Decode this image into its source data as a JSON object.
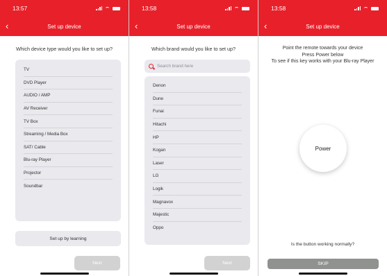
{
  "screen1": {
    "time": "13:57",
    "title": "Set up device",
    "question": "Which device type would you like to set up?",
    "device_types": [
      "TV",
      "DVD Player",
      "AUDIO / AMP",
      "AV Receiver",
      "TV Box",
      "Streaming / Media Box",
      "SAT/ Cable",
      "Blu-ray Player",
      "Projector",
      "Soundbar"
    ],
    "learning_label": "Set up by learning",
    "next_label": "Next"
  },
  "screen2": {
    "time": "13:58",
    "title": "Set up device",
    "question": "Which brand would you like to set up?",
    "search_placeholder": "Search brand here",
    "brands": [
      "Denon",
      "Dune",
      "Funai",
      "Hitachi",
      "HP",
      "Kogan",
      "Laser",
      "LG",
      "Logik",
      "Magnavox",
      "Majestic",
      "Oppo"
    ],
    "next_label": "Next"
  },
  "screen3": {
    "time": "13:58",
    "title": "Set up device",
    "instruction_1": "Point the remote towards your device",
    "instruction_2": "Press Power below",
    "instruction_3": "To see if this key works with your Blu-ray Player",
    "power_label": "Power",
    "working_question": "Is the button working normally?",
    "skip_label": "SKIP"
  },
  "icons": {
    "back": "back-arrow-icon",
    "search": "search-icon",
    "signal": "cell-signal-icon",
    "wifi": "wifi-icon",
    "battery": "battery-icon"
  },
  "colors": {
    "accent": "#e8202a",
    "panel": "#e9e9ee",
    "disabled_button": "#d2d2d2",
    "skip_button": "#8f928f"
  }
}
